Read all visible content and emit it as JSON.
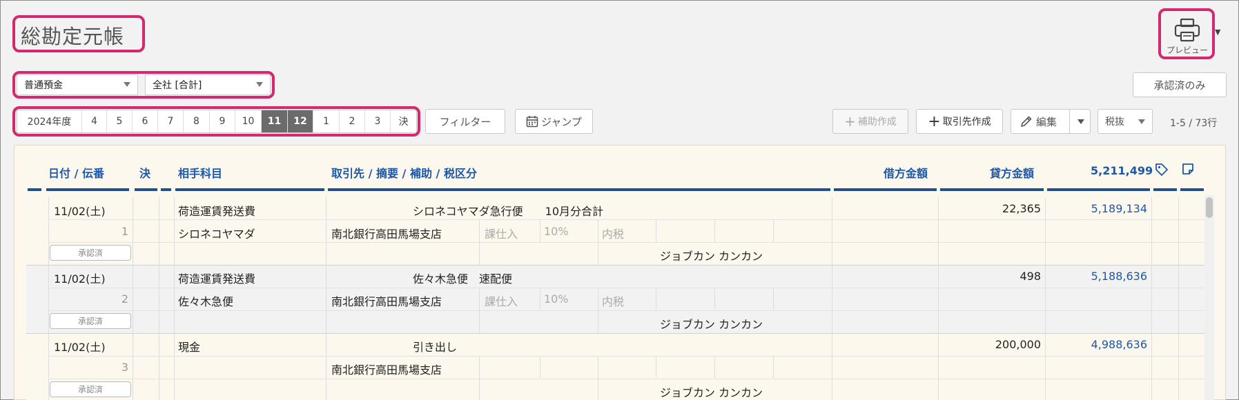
{
  "title": "総勘定元帳",
  "print": {
    "label": "プレビュー",
    "icon": "printer-icon"
  },
  "account_select": {
    "value": "普通預金"
  },
  "dept_select": {
    "value": "全社 [合計]"
  },
  "approved_only_label": "承認済のみ",
  "periods": {
    "year": "2024年度",
    "months": [
      "4",
      "5",
      "6",
      "7",
      "8",
      "9",
      "10",
      "11",
      "12",
      "1",
      "2",
      "3",
      "決"
    ],
    "active": [
      "11",
      "12"
    ]
  },
  "toolbar": {
    "filter_label": "フィルター",
    "jump_label": "ジャンプ",
    "sub_create_label": "補助作成",
    "partner_create_label": "取引先作成",
    "edit_label": "編集",
    "tax_label": "税抜"
  },
  "row_count": "1-5 / 73行",
  "columns": {
    "date": "日付 / 伝番",
    "settle": "決",
    "counter": "相手科目",
    "desc": "取引先 / 摘要 / 補助 / 税区分",
    "debit": "借方金額",
    "credit": "貸方金額",
    "balance": "5,211,499"
  },
  "entries": [
    {
      "date": "11/02(土)",
      "no": "1",
      "account": "荷造運賃発送費",
      "sub_account": "シロネコヤマダ",
      "summary": "シロネコヤマダ急行便　　10月分合計",
      "bank": "南北銀行高田馬場支店",
      "tax_type": "課仕入",
      "tax_rate": "10%",
      "tax_incl": "内税",
      "approver": "ジョブカン カンカン",
      "status": "承認済",
      "debit": "",
      "credit": "22,365",
      "balance": "5,189,134"
    },
    {
      "date": "11/02(土)",
      "no": "2",
      "account": "荷造運賃発送費",
      "sub_account": "佐々木急便",
      "summary": "佐々木急便　速配便",
      "bank": "南北銀行高田馬場支店",
      "tax_type": "課仕入",
      "tax_rate": "10%",
      "tax_incl": "内税",
      "approver": "ジョブカン カンカン",
      "status": "承認済",
      "debit": "",
      "credit": "498",
      "balance": "5,188,636"
    },
    {
      "date": "11/02(土)",
      "no": "3",
      "account": "現金",
      "sub_account": "",
      "summary": "引き出し",
      "bank": "南北銀行高田馬場支店",
      "tax_type": "",
      "tax_rate": "",
      "tax_incl": "",
      "approver": "ジョブカン カンカン",
      "status": "承認済",
      "debit": "",
      "credit": "200,000",
      "balance": "4,988,636"
    }
  ],
  "colors": {
    "accent": "#1d57a8",
    "highlight": "#d6286e",
    "row_bg": "#fdf8ee"
  }
}
